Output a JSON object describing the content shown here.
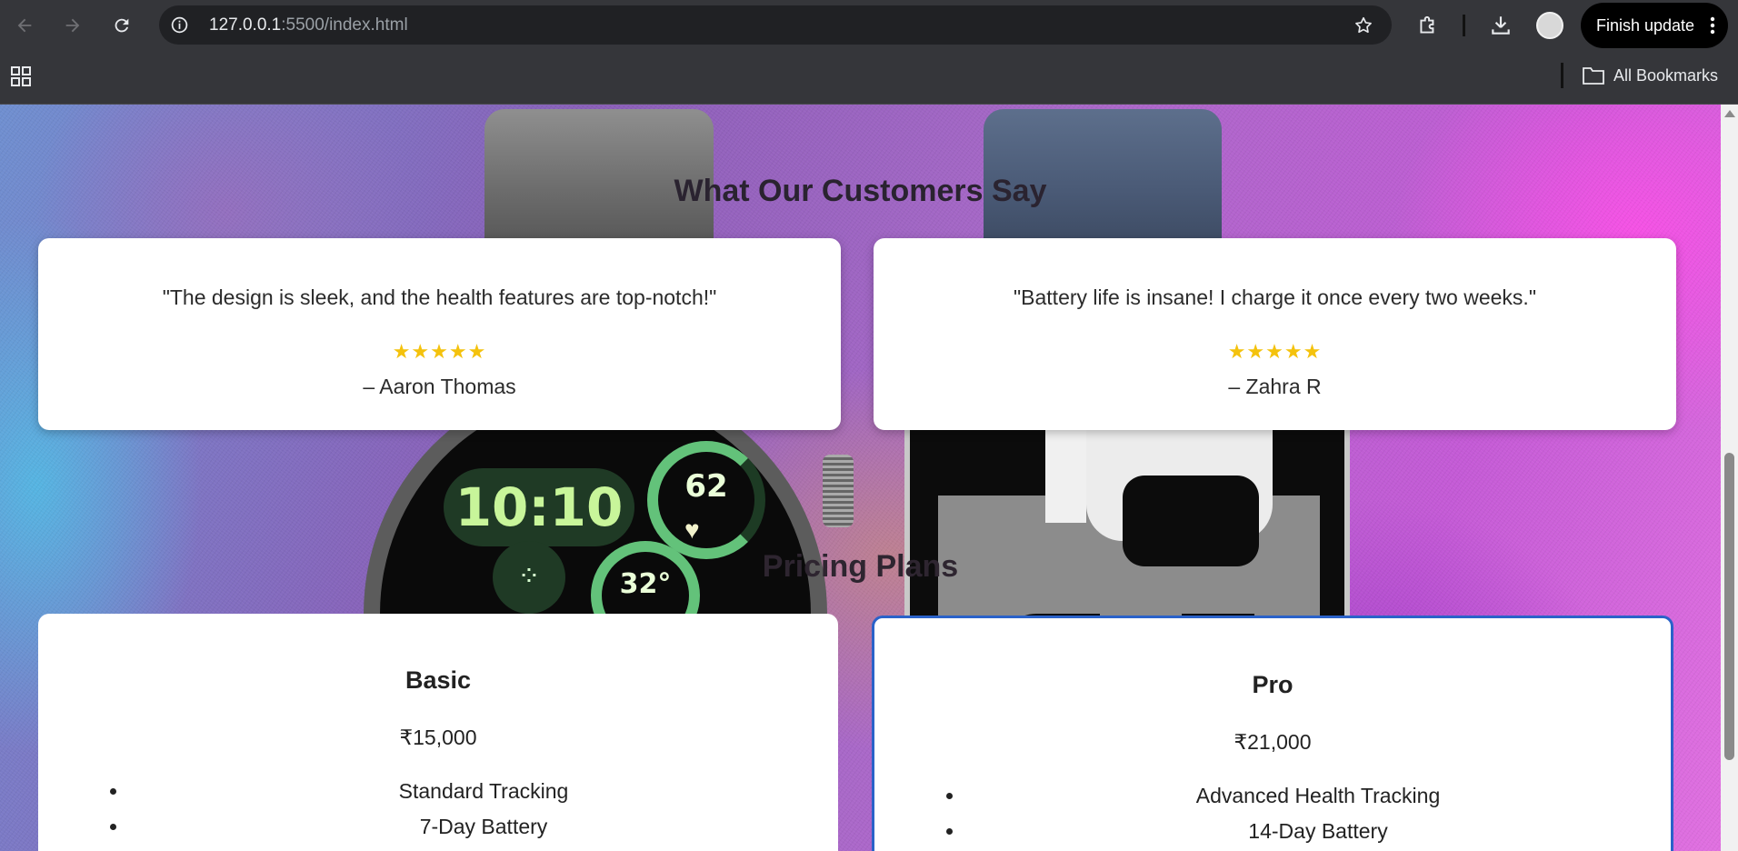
{
  "browser": {
    "url_host": "127.0.0.1",
    "url_rest": ":5500/index.html",
    "finish_update_label": "Finish update",
    "all_bookmarks_label": "All Bookmarks",
    "icons": [
      "back-icon",
      "forward-icon",
      "reload-icon",
      "site-info-icon",
      "star-icon",
      "extensions-icon",
      "download-icon",
      "profile-avatar",
      "more-icon",
      "apps-icon",
      "folder-icon"
    ]
  },
  "testimonials": {
    "title": "What Our Customers Say",
    "items": [
      {
        "quote": "\"The design is sleek, and the health features are top-notch!\"",
        "stars": "★★★★★",
        "rating": 5,
        "author": "– Aaron Thomas"
      },
      {
        "quote": "\"Battery life is insane! I charge it once every two weeks.\"",
        "stars": "★★★★★",
        "rating": 5,
        "author": "– Zahra R"
      }
    ]
  },
  "watch_face": {
    "time": "10:10",
    "heart_rate": "62",
    "temperature": "32°"
  },
  "pricing": {
    "title": "Pricing Plans",
    "plans": [
      {
        "name": "Basic",
        "price": "₹15,000",
        "features": [
          "Standard Tracking",
          "7-Day Battery"
        ]
      },
      {
        "name": "Pro",
        "price": "₹21,000",
        "features": [
          "Advanced Health Tracking",
          "14-Day Battery"
        ],
        "highlight_color": "#2a62c9"
      }
    ]
  },
  "colors": {
    "star": "#f4c20d",
    "toolbar": "#35363a",
    "omnibox": "#202124"
  }
}
